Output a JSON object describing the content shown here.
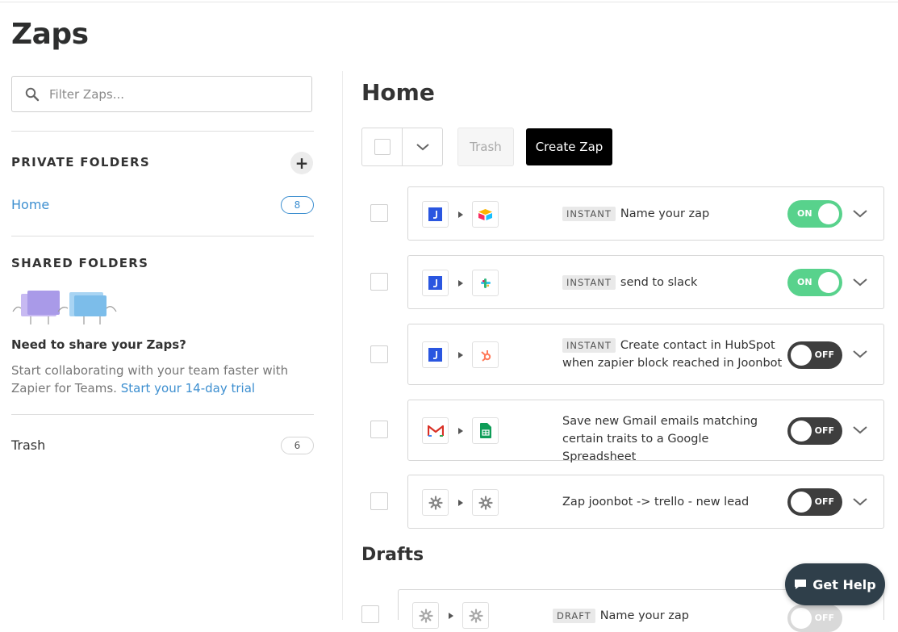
{
  "page": {
    "title": "Zaps"
  },
  "sidebar": {
    "search_placeholder": "Filter Zaps...",
    "private_folders": {
      "title": "PRIVATE FOLDERS",
      "items": [
        {
          "label": "Home",
          "count": "8"
        }
      ]
    },
    "shared_folders": {
      "title": "SHARED FOLDERS",
      "promo_title": "Need to share your Zaps?",
      "promo_text": "Start collaborating with your team faster with Zapier for Teams.",
      "promo_link": "Start your 14-day trial"
    },
    "trash": {
      "label": "Trash",
      "count": "6"
    }
  },
  "main": {
    "title": "Home",
    "toolbar": {
      "trash_label": "Trash",
      "create_label": "Create Zap"
    },
    "zaps": [
      {
        "tag": "INSTANT",
        "name": "Name your zap",
        "status": "ON",
        "trigger_icon": "joonbot-icon",
        "action_icon": "airtable-icon"
      },
      {
        "tag": "INSTANT",
        "name": "send to slack",
        "status": "ON",
        "trigger_icon": "joonbot-icon",
        "action_icon": "slack-icon"
      },
      {
        "tag": "INSTANT",
        "name": "Create contact in HubSpot when zapier block reached in Joonbot",
        "status": "OFF",
        "trigger_icon": "joonbot-icon",
        "action_icon": "hubspot-icon"
      },
      {
        "tag": "",
        "name": "Save new Gmail emails matching certain traits to a Google Spreadsheet",
        "status": "OFF",
        "trigger_icon": "gmail-icon",
        "action_icon": "google-sheets-icon"
      },
      {
        "tag": "",
        "name": "Zap joonbot -> trello - new lead",
        "status": "OFF",
        "trigger_icon": "gear-icon",
        "action_icon": "gear-icon"
      }
    ],
    "drafts_title": "Drafts",
    "drafts": [
      {
        "tag": "DRAFT",
        "name": "Name your zap",
        "status": "OFF",
        "trigger_icon": "gear-icon",
        "action_icon": "gear-icon"
      }
    ]
  },
  "help": {
    "label": "Get Help"
  },
  "colors": {
    "accent": "#3d8fd0",
    "toggle_on": "#58d28c",
    "toggle_off": "#3e3e3e",
    "help_bg": "#2f3f4a"
  }
}
